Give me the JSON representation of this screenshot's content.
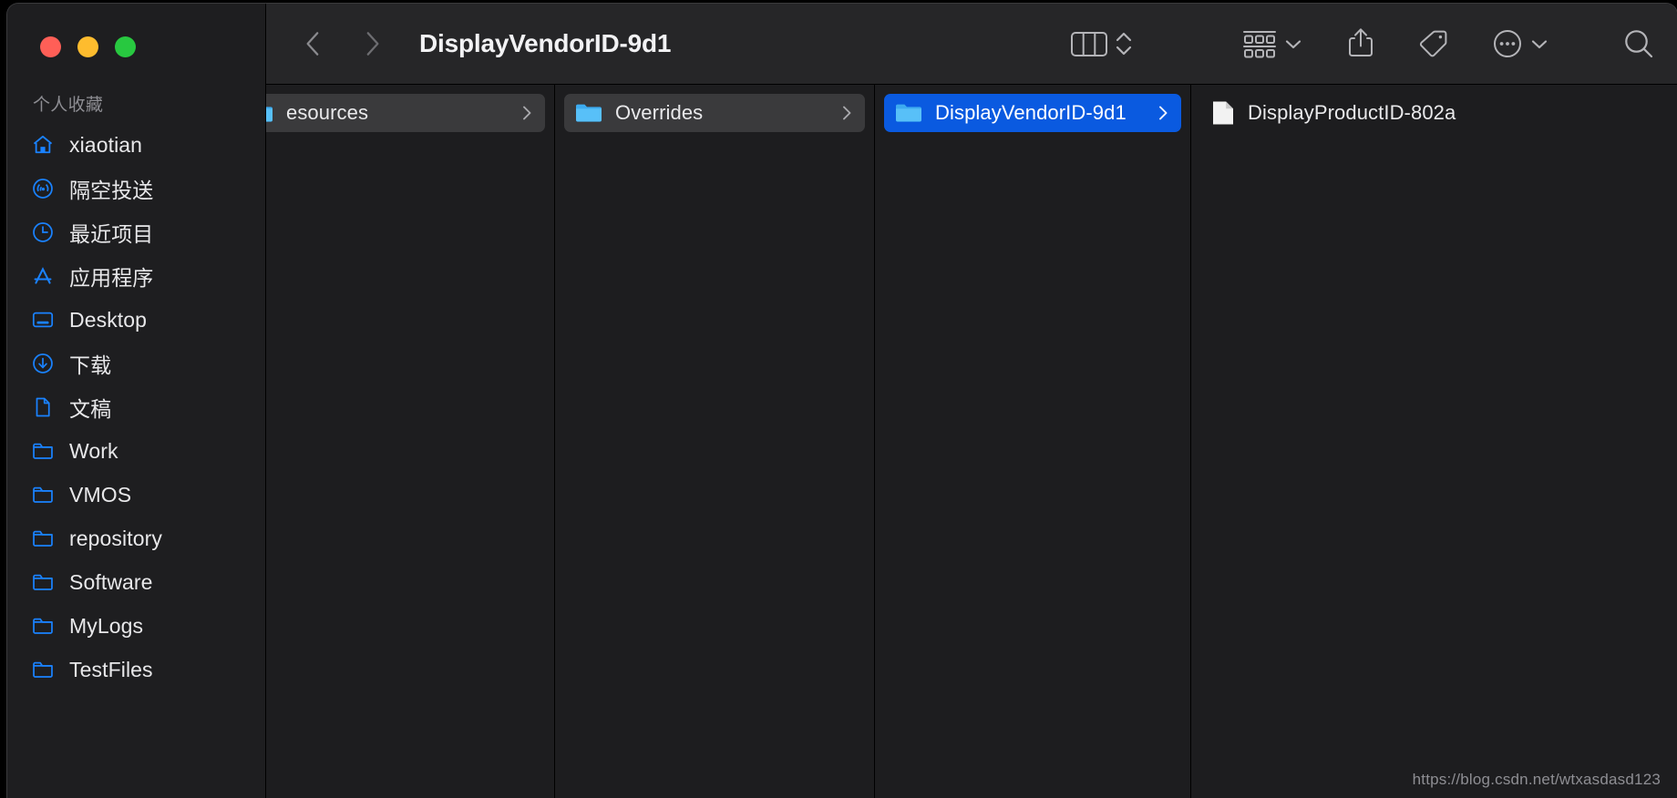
{
  "window": {
    "title": "DisplayVendorID-9d1",
    "traffic_lights": [
      {
        "name": "close",
        "color": "#ff5f57"
      },
      {
        "name": "minimize",
        "color": "#febc2e"
      },
      {
        "name": "maximize",
        "color": "#28c840"
      }
    ]
  },
  "toolbar": {
    "back_label": "Back",
    "forward_label": "Forward",
    "view_column_label": "Column View",
    "view_stepper_label": "View Options",
    "group_label": "Group Items",
    "group_caret_label": "Group Options",
    "share_label": "Share",
    "tags_label": "Tags",
    "more_label": "More",
    "more_caret_label": "More Options",
    "search_label": "Search"
  },
  "sidebar": {
    "section_title": "个人收藏",
    "items": [
      {
        "label": "xiaotian",
        "icon": "home-icon"
      },
      {
        "label": "隔空投送",
        "icon": "airdrop-icon"
      },
      {
        "label": "最近项目",
        "icon": "clock-icon"
      },
      {
        "label": "应用程序",
        "icon": "applications-icon"
      },
      {
        "label": "Desktop",
        "icon": "desktop-icon"
      },
      {
        "label": "下载",
        "icon": "download-icon"
      },
      {
        "label": "文稿",
        "icon": "document-icon"
      },
      {
        "label": "Work",
        "icon": "folder-icon"
      },
      {
        "label": "VMOS",
        "icon": "folder-icon"
      },
      {
        "label": "repository",
        "icon": "folder-icon"
      },
      {
        "label": "Software",
        "icon": "folder-icon"
      },
      {
        "label": "MyLogs",
        "icon": "folder-icon"
      },
      {
        "label": "TestFiles",
        "icon": "folder-icon"
      }
    ]
  },
  "columns": [
    {
      "name": "column-resources",
      "rows": [
        {
          "label": "esources",
          "type": "folder",
          "state": "highlighted",
          "has_arrow": true
        }
      ]
    },
    {
      "name": "column-overrides",
      "rows": [
        {
          "label": "Overrides",
          "type": "folder",
          "state": "highlighted",
          "has_arrow": true
        }
      ]
    },
    {
      "name": "column-displayvendorid",
      "rows": [
        {
          "label": "DisplayVendorID-9d1",
          "type": "folder",
          "state": "selected",
          "has_arrow": true
        }
      ]
    },
    {
      "name": "column-displayproductid",
      "rows": [
        {
          "label": "DisplayProductID-802a",
          "type": "file",
          "state": "normal",
          "has_arrow": false
        }
      ]
    }
  ],
  "watermark": "https://blog.csdn.net/wtxasdasd123",
  "colors": {
    "accent": "#0a5ae0",
    "folder_blue": "#4fb7f5",
    "sidebar_icon_blue": "#1a82ff",
    "window_bg": "#1d1d1f",
    "toolbar_bg": "#262628"
  }
}
